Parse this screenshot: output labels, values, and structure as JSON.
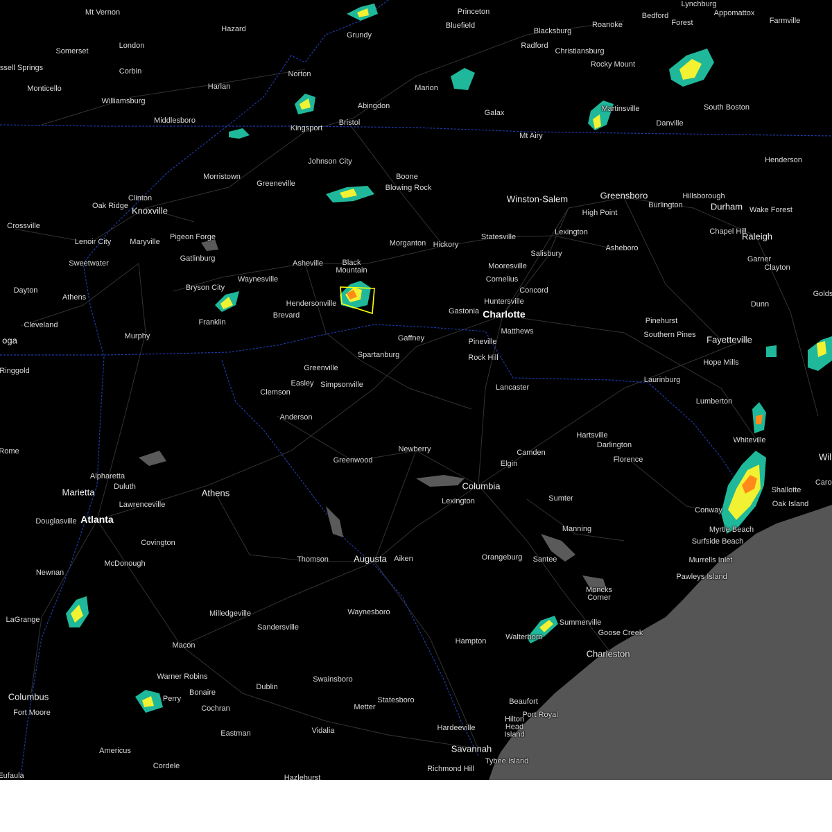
{
  "map": {
    "colors": {
      "background": "#000000",
      "ocean": "#555555",
      "roads": "#3a3a3a",
      "state_border": "#1f3aa8",
      "warning_polygon": "#ffff00",
      "radar_light": "#1fb89a",
      "radar_moderate": "#f2f232",
      "radar_heavy": "#ff8a1a",
      "radar_intense": "#e03a1a"
    },
    "cities": [
      {
        "name": "Mt Vernon",
        "size": "small"
      },
      {
        "name": "Hazard",
        "size": "small"
      },
      {
        "name": "Grundy",
        "size": "small"
      },
      {
        "name": "Princeton",
        "size": "small"
      },
      {
        "name": "Bluefield",
        "size": "small"
      },
      {
        "name": "Lynchburg",
        "size": "small"
      },
      {
        "name": "Bedford",
        "size": "small"
      },
      {
        "name": "Forest",
        "size": "small"
      },
      {
        "name": "Appomattox",
        "size": "small"
      },
      {
        "name": "Farmville",
        "size": "small"
      },
      {
        "name": "Somerset",
        "size": "small"
      },
      {
        "name": "London",
        "size": "small"
      },
      {
        "name": "Blacksburg",
        "size": "small"
      },
      {
        "name": "Roanoke",
        "size": "small"
      },
      {
        "name": "Radford",
        "size": "small"
      },
      {
        "name": "Christiansburg",
        "size": "small"
      },
      {
        "name": "ssell Springs",
        "size": "small"
      },
      {
        "name": "Corbin",
        "size": "small"
      },
      {
        "name": "Norton",
        "size": "small"
      },
      {
        "name": "Rocky Mount",
        "size": "small"
      },
      {
        "name": "Monticello",
        "size": "small"
      },
      {
        "name": "Harlan",
        "size": "small"
      },
      {
        "name": "Marion",
        "size": "small"
      },
      {
        "name": "Williamsburg",
        "size": "small"
      },
      {
        "name": "Abingdon",
        "size": "small"
      },
      {
        "name": "Martinsville",
        "size": "small"
      },
      {
        "name": "South Boston",
        "size": "small"
      },
      {
        "name": "Galax",
        "size": "small"
      },
      {
        "name": "Middlesboro",
        "size": "small"
      },
      {
        "name": "Bristol",
        "size": "small"
      },
      {
        "name": "Danville",
        "size": "small"
      },
      {
        "name": "Kingsport",
        "size": "small"
      },
      {
        "name": "Mt Airy",
        "size": "small"
      },
      {
        "name": "Henderson",
        "size": "small"
      },
      {
        "name": "Johnson City",
        "size": "small"
      },
      {
        "name": "Morristown",
        "size": "small"
      },
      {
        "name": "Boone",
        "size": "small"
      },
      {
        "name": "Greeneville",
        "size": "small"
      },
      {
        "name": "Blowing Rock",
        "size": "small"
      },
      {
        "name": "Clinton",
        "size": "small"
      },
      {
        "name": "Winston-Salem",
        "size": "medium"
      },
      {
        "name": "Greensboro",
        "size": "medium"
      },
      {
        "name": "Hillsborough",
        "size": "small"
      },
      {
        "name": "Oak Ridge",
        "size": "small"
      },
      {
        "name": "Knoxville",
        "size": "medium"
      },
      {
        "name": "Burlington",
        "size": "small"
      },
      {
        "name": "Durham",
        "size": "medium"
      },
      {
        "name": "High Point",
        "size": "small"
      },
      {
        "name": "Wake Forest",
        "size": "small"
      },
      {
        "name": "Crossville",
        "size": "small"
      },
      {
        "name": "Lexington",
        "size": "small"
      },
      {
        "name": "Chapel Hill",
        "size": "small"
      },
      {
        "name": "Pigeon Forge",
        "size": "small"
      },
      {
        "name": "Raleigh",
        "size": "medium"
      },
      {
        "name": "Lenoir City",
        "size": "small"
      },
      {
        "name": "Maryville",
        "size": "small"
      },
      {
        "name": "Morganton",
        "size": "small"
      },
      {
        "name": "Hickory",
        "size": "small"
      },
      {
        "name": "Statesville",
        "size": "small"
      },
      {
        "name": "Asheboro",
        "size": "small"
      },
      {
        "name": "Gatlinburg",
        "size": "small"
      },
      {
        "name": "Garner",
        "size": "small"
      },
      {
        "name": "Salisbury",
        "size": "small"
      },
      {
        "name": "Sweetwater",
        "size": "small"
      },
      {
        "name": "Asheville",
        "size": "small"
      },
      {
        "name": "Black Mountain",
        "size": "small"
      },
      {
        "name": "Clayton",
        "size": "small"
      },
      {
        "name": "Mooresville",
        "size": "small"
      },
      {
        "name": "Waynesville",
        "size": "small"
      },
      {
        "name": "Cornelius",
        "size": "small"
      },
      {
        "name": "Dayton",
        "size": "small"
      },
      {
        "name": "Bryson City",
        "size": "small"
      },
      {
        "name": "Concord",
        "size": "small"
      },
      {
        "name": "Golds",
        "size": "small"
      },
      {
        "name": "Athens",
        "size": "small"
      },
      {
        "name": "Hendersonville",
        "size": "small"
      },
      {
        "name": "Huntersville",
        "size": "small"
      },
      {
        "name": "Dunn",
        "size": "small"
      },
      {
        "name": "Gastonia",
        "size": "small"
      },
      {
        "name": "Charlotte",
        "size": "major"
      },
      {
        "name": "Brevard",
        "size": "small"
      },
      {
        "name": "Pinehurst",
        "size": "small"
      },
      {
        "name": "Cleveland",
        "size": "small"
      },
      {
        "name": "Franklin",
        "size": "small"
      },
      {
        "name": "Matthews",
        "size": "small"
      },
      {
        "name": "Southern Pines",
        "size": "small"
      },
      {
        "name": "Murphy",
        "size": "small"
      },
      {
        "name": "Gaffney",
        "size": "small"
      },
      {
        "name": "Fayetteville",
        "size": "medium"
      },
      {
        "name": "Pineville",
        "size": "small"
      },
      {
        "name": "oga",
        "size": "medium"
      },
      {
        "name": "Spartanburg",
        "size": "small"
      },
      {
        "name": "Rock Hill",
        "size": "small"
      },
      {
        "name": "Hope Mills",
        "size": "small"
      },
      {
        "name": "Ringgold",
        "size": "small"
      },
      {
        "name": "Greenville",
        "size": "small"
      },
      {
        "name": "Laurinburg",
        "size": "small"
      },
      {
        "name": "Easley",
        "size": "small"
      },
      {
        "name": "Simpsonville",
        "size": "small"
      },
      {
        "name": "Clemson",
        "size": "small"
      },
      {
        "name": "Lancaster",
        "size": "small"
      },
      {
        "name": "Lumberton",
        "size": "small"
      },
      {
        "name": "Anderson",
        "size": "small"
      },
      {
        "name": "Hartsville",
        "size": "small"
      },
      {
        "name": "Whiteville",
        "size": "small"
      },
      {
        "name": "Darlington",
        "size": "small"
      },
      {
        "name": "Newberry",
        "size": "small"
      },
      {
        "name": "Rome",
        "size": "small"
      },
      {
        "name": "Camden",
        "size": "small"
      },
      {
        "name": "Wil",
        "size": "medium"
      },
      {
        "name": "Greenwood",
        "size": "small"
      },
      {
        "name": "Florence",
        "size": "small"
      },
      {
        "name": "Elgin",
        "size": "small"
      },
      {
        "name": "Alpharetta",
        "size": "small"
      },
      {
        "name": "Carol",
        "size": "small"
      },
      {
        "name": "Columbia",
        "size": "medium"
      },
      {
        "name": "Duluth",
        "size": "small"
      },
      {
        "name": "Shallotte",
        "size": "small"
      },
      {
        "name": "Marietta",
        "size": "medium"
      },
      {
        "name": "Athens",
        "size": "medium"
      },
      {
        "name": "Lexington",
        "size": "small"
      },
      {
        "name": "Sumter",
        "size": "small"
      },
      {
        "name": "Lawrenceville",
        "size": "small"
      },
      {
        "name": "Oak Island",
        "size": "small"
      },
      {
        "name": "Conway",
        "size": "small"
      },
      {
        "name": "Myrtle Beach",
        "size": "small"
      },
      {
        "name": "Atlanta",
        "size": "major"
      },
      {
        "name": "Douglasville",
        "size": "small"
      },
      {
        "name": "Manning",
        "size": "small"
      },
      {
        "name": "Surfside Beach",
        "size": "small"
      },
      {
        "name": "Covington",
        "size": "small"
      },
      {
        "name": "Thomson",
        "size": "small"
      },
      {
        "name": "Augusta",
        "size": "medium"
      },
      {
        "name": "Aiken",
        "size": "small"
      },
      {
        "name": "Orangeburg",
        "size": "small"
      },
      {
        "name": "Santee",
        "size": "small"
      },
      {
        "name": "Murrells Inlet",
        "size": "small"
      },
      {
        "name": "McDonough",
        "size": "small"
      },
      {
        "name": "Pawleys Island",
        "size": "small"
      },
      {
        "name": "Newnan",
        "size": "small"
      },
      {
        "name": "Moncks Corner",
        "size": "small"
      },
      {
        "name": "Waynesboro",
        "size": "small"
      },
      {
        "name": "Milledgeville",
        "size": "small"
      },
      {
        "name": "Summerville",
        "size": "small"
      },
      {
        "name": "LaGrange",
        "size": "small"
      },
      {
        "name": "Sandersville",
        "size": "small"
      },
      {
        "name": "Goose Creek",
        "size": "small"
      },
      {
        "name": "Walterboro",
        "size": "small"
      },
      {
        "name": "Hampton",
        "size": "small"
      },
      {
        "name": "Macon",
        "size": "small"
      },
      {
        "name": "Charleston",
        "size": "medium"
      },
      {
        "name": "Warner Robins",
        "size": "small"
      },
      {
        "name": "Swainsboro",
        "size": "small"
      },
      {
        "name": "Bonaire",
        "size": "small"
      },
      {
        "name": "Dublin",
        "size": "small"
      },
      {
        "name": "Statesboro",
        "size": "small"
      },
      {
        "name": "Columbus",
        "size": "medium"
      },
      {
        "name": "Perry",
        "size": "small"
      },
      {
        "name": "Beaufort",
        "size": "small"
      },
      {
        "name": "Fort Moore",
        "size": "small"
      },
      {
        "name": "Cochran",
        "size": "small"
      },
      {
        "name": "Metter",
        "size": "small"
      },
      {
        "name": "Port Royal",
        "size": "small"
      },
      {
        "name": "Hilton Head Island",
        "size": "small"
      },
      {
        "name": "Hardeeville",
        "size": "small"
      },
      {
        "name": "Vidalia",
        "size": "small"
      },
      {
        "name": "Eastman",
        "size": "small"
      },
      {
        "name": "Savannah",
        "size": "medium"
      },
      {
        "name": "Americus",
        "size": "small"
      },
      {
        "name": "Tybee Island",
        "size": "small"
      },
      {
        "name": "Cordele",
        "size": "small"
      },
      {
        "name": "Richmond Hill",
        "size": "small"
      },
      {
        "name": "Eufaula",
        "size": "small"
      },
      {
        "name": "Hazlehurst",
        "size": "small"
      }
    ]
  }
}
